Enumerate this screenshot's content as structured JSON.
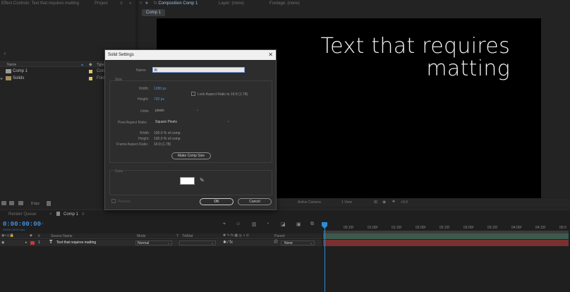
{
  "project_panel": {
    "tab_effect_controls": "Effect Controls: Text that requires matting",
    "tab_project": "Project",
    "columns": {
      "name": "Name",
      "type": "Type"
    },
    "items": [
      {
        "name": "Comp 1",
        "type": "Com",
        "label_color": "#d6c86a"
      },
      {
        "name": "Solids",
        "type": "Fold",
        "label_color": "#d6c86a"
      }
    ],
    "bit_depth": "8 bpc"
  },
  "composition_panel": {
    "tab_composition": "Composition Comp 1",
    "tab_layer": "Layer: (none)",
    "tab_footage": "Footage: (none)",
    "comp_tab": "Comp 1",
    "canvas_text_line1": "Text that requires",
    "canvas_text_line2": "matting",
    "active_camera": "Active Camera",
    "view_count": "1 View",
    "plus": "+0.0"
  },
  "dialog": {
    "title": "Solid Settings",
    "name_label": "Name:",
    "name_value": "fil",
    "size_label": "Size",
    "width_label": "Width:",
    "width_value": "1280 px",
    "height_label": "Height:",
    "height_value": "720 px",
    "lock_label": "Lock Aspect Ratio to 16:9 (1.78)",
    "units_label": "Units:",
    "units_value": "pixels",
    "par_label": "Pixel Aspect Ratio:",
    "par_value": "Square Pixels",
    "width_pct_label": "Width:",
    "width_pct_value": "100.0 % of comp",
    "height_pct_label": "Height:",
    "height_pct_value": "100.0 % of comp",
    "far_label": "Frame Aspect Ratio:",
    "far_value": "16:9 (1.78)",
    "make_comp_size": "Make Comp Size",
    "color_label": "Color",
    "color_value": "#ffffff",
    "preview_label": "Preview",
    "ok_label": "OK",
    "cancel_label": "Cancel"
  },
  "timeline": {
    "tab_render_queue": "Render Queue",
    "tab_comp": "Comp 1",
    "timecode": "0:00:00:00",
    "frame_info": "00000 (30.00 fps)",
    "headers": {
      "source_name": "Source Name",
      "mode": "Mode",
      "trkmat": "TrkMat",
      "parent": "Parent"
    },
    "layer": {
      "index": "1",
      "name": "Text that requires matting",
      "mode": "Normal",
      "parent": "None",
      "label_color": "#c23a3a"
    },
    "ruler_ticks": [
      "00:15f",
      "01:00f",
      "01:15f",
      "02:00f",
      "02:15f",
      "03:00f",
      "03:15f",
      "04:00f",
      "04:15f",
      "05:0"
    ]
  }
}
